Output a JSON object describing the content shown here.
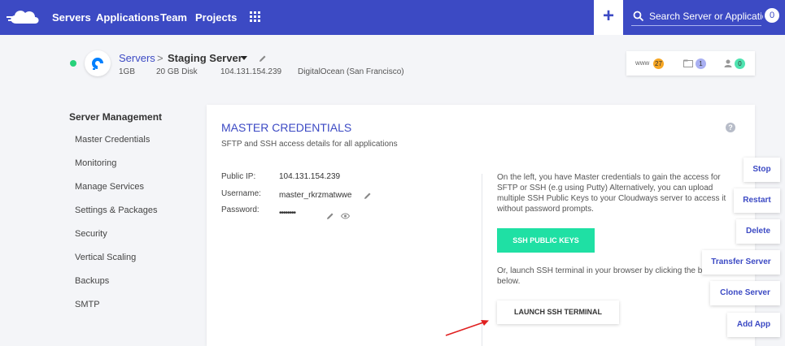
{
  "topbar": {
    "nav": [
      "Servers",
      "Applications",
      "Team",
      "Projects"
    ],
    "search_placeholder": "Search Server or Application",
    "notification_count": "0",
    "plus_label": "+"
  },
  "server": {
    "breadcrumb_root": "Servers",
    "breadcrumb_sep": ">",
    "name": "Staging Server",
    "ram": "1GB",
    "disk": "20 GB Disk",
    "ip": "104.131.154.239",
    "provider": "DigitalOcean (San Francisco)",
    "counts": [
      {
        "label": "www",
        "value": "27",
        "color": "#f6a623"
      },
      {
        "label": "",
        "value": "1",
        "color": "#a9b0f2"
      },
      {
        "label": "",
        "value": "0",
        "color": "#4fe3b0"
      }
    ]
  },
  "sidebar": {
    "heading": "Server Management",
    "items": [
      "Master Credentials",
      "Monitoring",
      "Manage Services",
      "Settings & Packages",
      "Security",
      "Vertical Scaling",
      "Backups",
      "SMTP"
    ]
  },
  "card": {
    "title": "MASTER CREDENTIALS",
    "subtitle": "SFTP and SSH access details for all applications",
    "help": "?",
    "public_ip_label": "Public IP:",
    "public_ip": "104.131.154.239",
    "username_label": "Username:",
    "username": "master_rkrzmatwwe",
    "password_label": "Password:",
    "password_mask": "••••••••",
    "info": "On the left, you have Master credentials to gain the access for SFTP or SSH (e.g using Putty) Alternatively, you can upload multiple SSH Public Keys to your Cloudways server to access it without password prompts.",
    "ssh_keys_button": "SSH PUBLIC KEYS",
    "info2": "Or, launch SSH terminal in your browser by clicking the button below.",
    "terminal_button": "LAUNCH SSH TERMINAL"
  },
  "actions": [
    "Stop",
    "Restart",
    "Delete",
    "Transfer Server",
    "Clone Server",
    "Add App"
  ],
  "colors": {
    "brand": "#3c4ac4",
    "accent_green": "#1fe0a4",
    "status_online": "#27d27b",
    "arrow": "#e02020"
  }
}
